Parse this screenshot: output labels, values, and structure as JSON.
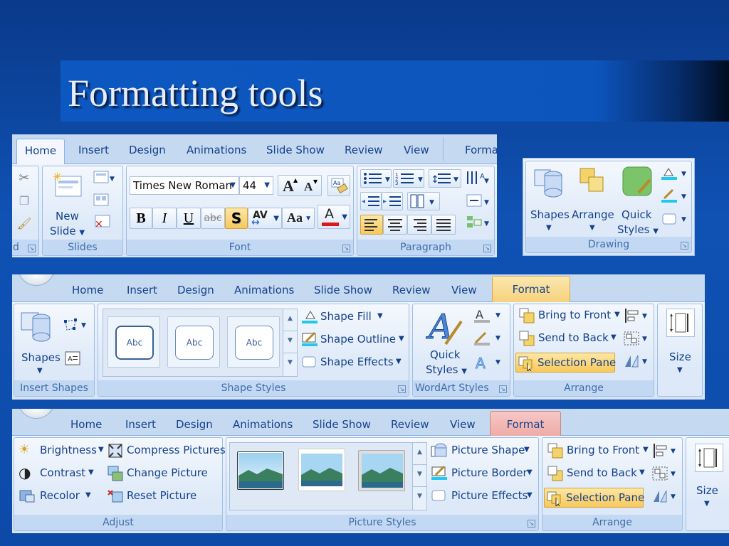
{
  "slide": {
    "title": "Formatting tools"
  },
  "ribbon1": {
    "tabs": [
      "Home",
      "Insert",
      "Design",
      "Animations",
      "Slide Show",
      "Review",
      "View",
      "Forma"
    ],
    "clipboard_label_fragment": "d",
    "slides": {
      "new_slide_line1": "New",
      "new_slide_line2": "Slide",
      "group_label": "Slides"
    },
    "font": {
      "family": "Times New Roman",
      "size": "44",
      "bold": "B",
      "italic": "I",
      "underline": "U",
      "strike": "abc",
      "shadow": "S",
      "spacing": "AV",
      "case": "Aa",
      "color_a": "A",
      "grow": "A",
      "shrink": "A",
      "group_label": "Font"
    },
    "paragraph": {
      "group_label": "Paragraph"
    }
  },
  "drawing": {
    "shapes": "Shapes",
    "arrange": "Arrange",
    "quick_line1": "Quick",
    "quick_line2": "Styles",
    "group_label": "Drawing"
  },
  "ribbon2": {
    "tabs": [
      "Home",
      "Insert",
      "Design",
      "Animations",
      "Slide Show",
      "Review",
      "View",
      "Format"
    ],
    "insert_shapes": {
      "shapes": "Shapes",
      "group_label": "Insert Shapes"
    },
    "shape_styles": {
      "thumbs": [
        "Abc",
        "Abc",
        "Abc"
      ],
      "fill": "Shape Fill",
      "outline": "Shape Outline",
      "effects": "Shape Effects",
      "group_label": "Shape Styles"
    },
    "wordart": {
      "quick_line1": "Quick",
      "quick_line2": "Styles",
      "group_label": "WordArt Styles"
    },
    "arrange": {
      "front": "Bring to Front",
      "back": "Send to Back",
      "pane": "Selection Pane",
      "group_label": "Arrange"
    },
    "size": {
      "label": "Size"
    }
  },
  "ribbon3": {
    "tabs": [
      "Home",
      "Insert",
      "Design",
      "Animations",
      "Slide Show",
      "Review",
      "View",
      "Format"
    ],
    "adjust": {
      "brightness": "Brightness",
      "contrast": "Contrast",
      "recolor": "Recolor",
      "compress": "Compress Pictures",
      "change": "Change Picture",
      "reset": "Reset Picture",
      "group_label": "Adjust"
    },
    "picture_styles": {
      "shape": "Picture Shape",
      "border": "Picture Border",
      "effects": "Picture Effects",
      "group_label": "Picture Styles"
    },
    "arrange": {
      "front": "Bring to Front",
      "back": "Send to Back",
      "pane": "Selection Pane",
      "group_label": "Arrange"
    },
    "size": {
      "label": "Size"
    }
  },
  "colors": {
    "accent_blue": "#15428b",
    "font_color_red": "#e0141c",
    "highlight_cyan": "#21c8f0"
  }
}
